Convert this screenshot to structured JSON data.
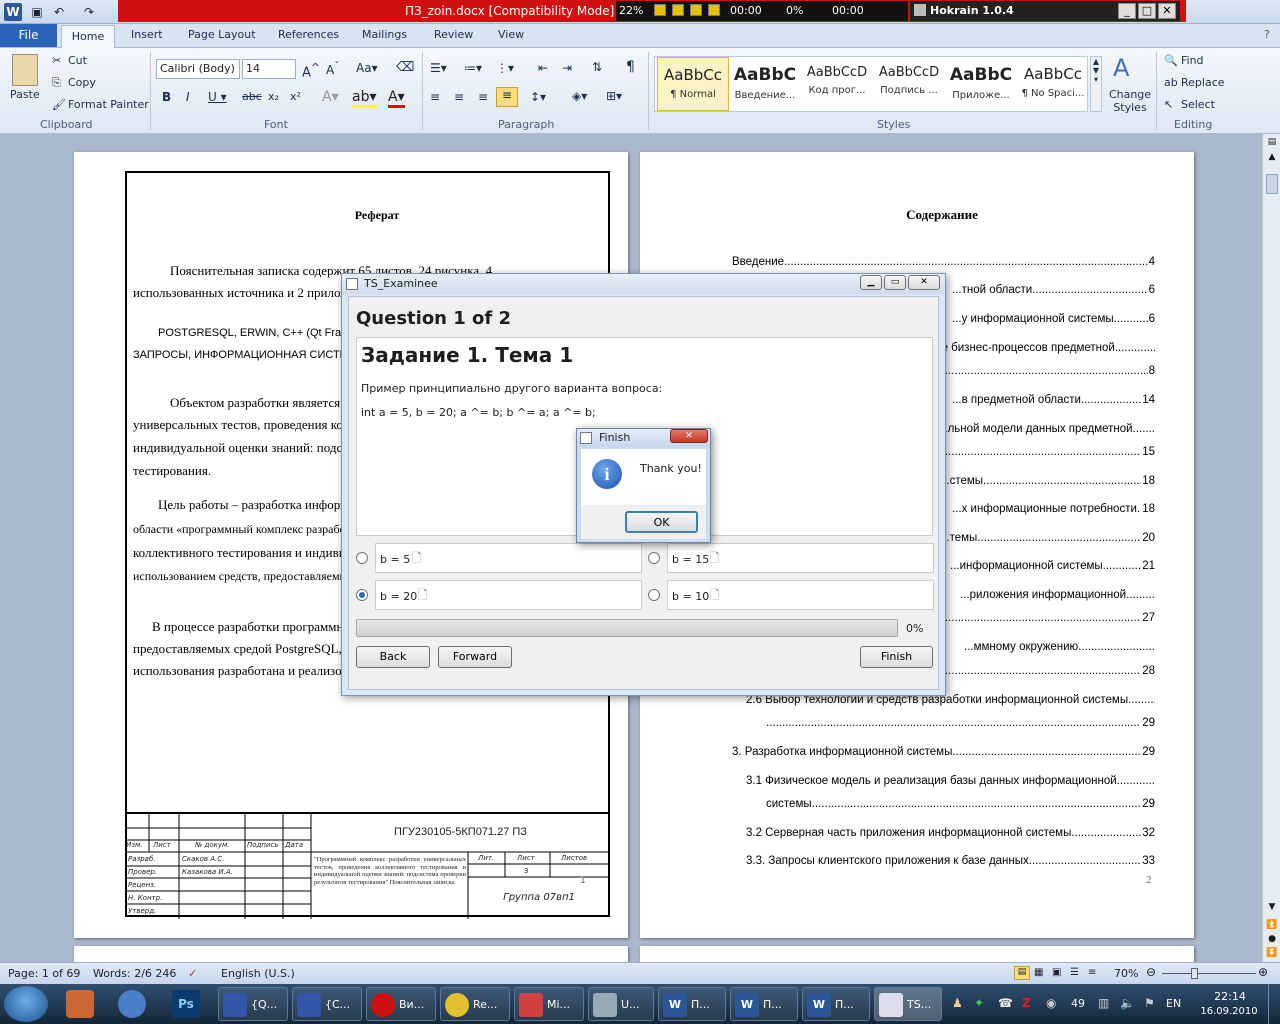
{
  "window": {
    "doc_title": "ПЗ_zoin.docx [Compatibility Mode]",
    "player": {
      "percent": "22%",
      "time1": "00:00",
      "mid_percent": "0%",
      "time2": "00:00"
    },
    "hokrain_title": "Hokrain 1.0.4"
  },
  "tabs": [
    "File",
    "Home",
    "Insert",
    "Page Layout",
    "References",
    "Mailings",
    "Review",
    "View"
  ],
  "ribbon": {
    "clipboard": {
      "paste": "Paste",
      "cut": "Cut",
      "copy": "Copy",
      "format_painter": "Format Painter",
      "label": "Clipboard"
    },
    "font": {
      "name": "Calibri (Body)",
      "size": "14",
      "label": "Font"
    },
    "paragraph": {
      "label": "Paragraph"
    },
    "styles": {
      "items": [
        {
          "preview": "AaBbCc",
          "name": "¶ Normal"
        },
        {
          "preview": "AaBbC",
          "name": "Введение..."
        },
        {
          "preview": "AaBbCcD",
          "name": "Код прог..."
        },
        {
          "preview": "AaBbCcD",
          "name": "Подпись ..."
        },
        {
          "preview": "AaBbC",
          "name": "Приложе..."
        },
        {
          "preview": "AaBbCc",
          "name": "¶ No Spaci..."
        }
      ],
      "change": "Change Styles",
      "label": "Styles"
    },
    "editing": {
      "find": "Find",
      "replace": "Replace",
      "select": "Select",
      "label": "Editing"
    }
  },
  "page_left": {
    "heading": "Реферат",
    "p1a": "Пояснительная записка содержит 65 листов, 24 рисунка, 4",
    "p1b": "использованных источника и 2 приложения.",
    "p2a": "POSTGRESQL, ERWIN, C++ (Qt Framework), ПРЕДМЕТНАЯ ОБЛАСТЬ,",
    "p2b": "ЗАПРОСЫ, ИНФОРМАЦИОННАЯ СИСТЕМА",
    "p3a": "Объектом разработки является программный комплекс разработки",
    "p3b": "универсальных тестов, проведения коллективного тестирования и",
    "p3c": "индивидуальной оценки знаний: подсистема проверки результатов",
    "p3d": "тестирования.",
    "p4a": "Цель работы – разработка информационной системы предметной",
    "p4b": "области «программный комплекс разработки универсальных тестов, проведения",
    "p4c": "коллективного тестирования и индивидуальной оценки знаний» с",
    "p4d": "использованием средств, предоставляемых",
    "p5a": "В процессе разработки программного обеспечения с использованием средств,",
    "p5b": "предоставляемых средой PostgreSQL,",
    "p5c": "использования разработана и реализована",
    "stamp": {
      "code": "ПГУ230105-5КП071.27 ПЗ",
      "cols": [
        "Изм.",
        "Лист",
        "№ докум.",
        "Подпись",
        "Дата"
      ],
      "rows": [
        "Разраб.",
        "Провер.",
        "Реценз.",
        "Н. Контр.",
        "Утверд."
      ],
      "names": [
        "Скаков А.С.",
        "Казакова И.А."
      ],
      "desc": "\"Программный комплекс разработки универсальных тестов, проведения коллективного тестирования и индивидуальной оценки знаний: подсистема проверки результатов тестирования\" Пояснительная записка.",
      "lit": "Лит.",
      "list": "Лист",
      "listov": "Листов",
      "sheet": "3",
      "group": "Группа 07вп1",
      "pnum": "1"
    }
  },
  "page_right": {
    "heading": "Содержание",
    "toc": [
      {
        "t": "Введение",
        "p": "4"
      },
      {
        "t": "...тной области",
        "p": "6"
      },
      {
        "t": "...у информационной системы",
        "p": "6"
      },
      {
        "t": "...е бизнес-процессов предметной",
        "p": ""
      },
      {
        "t": "",
        "p": "8"
      },
      {
        "t": "...в предметной области",
        "p": "14"
      },
      {
        "t": "...льной модели данных предметной",
        "p": ""
      },
      {
        "t": "",
        "p": "15"
      },
      {
        "t": "...стемы",
        "p": "18"
      },
      {
        "t": "...х информационные потребности",
        "p": "18"
      },
      {
        "t": "...темы",
        "p": "20"
      },
      {
        "t": "...информационной системы",
        "p": "21"
      },
      {
        "t": "...риложения информационной",
        "p": ""
      },
      {
        "t": "",
        "p": "27"
      },
      {
        "t": "...ммному окружению",
        "p": ""
      },
      {
        "t": "",
        "p": "28"
      },
      {
        "t": "2.6 Выбор технологии и средств разработки информационной системы",
        "p": ""
      },
      {
        "t": "",
        "p": "29"
      },
      {
        "t": "3. Разработка информационной системы",
        "p": "29"
      },
      {
        "t": "3.1 Физическое модель и реализация базы данных информационной",
        "p": ""
      },
      {
        "t": "системы",
        "p": "29"
      },
      {
        "t": "3.2 Серверная часть приложения информационной системы",
        "p": "32"
      },
      {
        "t": "3.3. Запросы клиентского приложения к базе данных",
        "p": "33"
      }
    ],
    "pnum": "2"
  },
  "dialog": {
    "title": "TS_Examinee",
    "question": "Question 1 of 2",
    "task_title": "Задание 1. Тема 1",
    "task_text": "Пример принципиально другого варианта вопроса:",
    "code": "int a = 5, b = 20; a ^= b; b ^= a; a ^= b;",
    "options": [
      "b = 5",
      "b = 15",
      "b = 20",
      "b = 10"
    ],
    "progress_value": 0,
    "progress_label": "0%",
    "back": "Back",
    "forward": "Forward",
    "finish": "Finish"
  },
  "finish_box": {
    "title": "Finish",
    "message": "Thank you!",
    "ok": "OK"
  },
  "status": {
    "page": "Page: 1 of 69",
    "words": "Words: 2/6 246",
    "lang": "English (U.S.)",
    "zoom": "70%"
  },
  "taskbar": {
    "items": [
      "{Q...",
      "{C...",
      "Ви...",
      "Re...",
      "Mi...",
      "U...",
      "П...",
      "П...",
      "П...",
      "TS..."
    ],
    "tray_num": "49",
    "lang": "EN",
    "time": "22:14",
    "date": "16.09.2010"
  }
}
